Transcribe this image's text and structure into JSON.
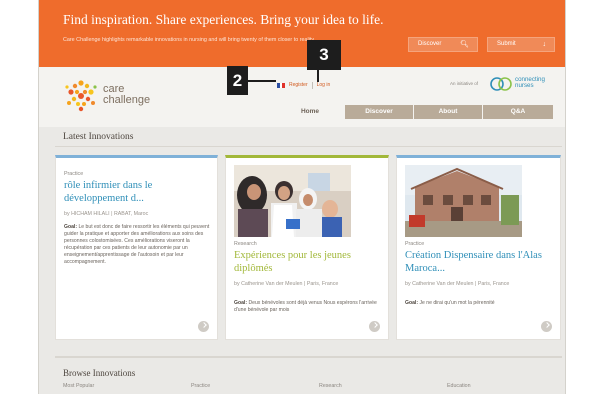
{
  "banner": {
    "headline": "Find inspiration. Share experiences. Bring your idea to life.",
    "description": "Care Challenge highlights remarkable innovations in nursing and will bring twenty of them closer to reality.",
    "discover_label": "Discover",
    "submit_label": "Submit",
    "accent_color": "#ef6c2c"
  },
  "header": {
    "logo_line1": "care",
    "logo_line2": "challenge",
    "register_label": "Register",
    "login_label": "Log in",
    "partner_label": "An initiative of",
    "partner_name_line1": "connecting",
    "partner_name_line2": "nurses"
  },
  "nav": {
    "tabs": [
      {
        "label": "Home",
        "active": true
      },
      {
        "label": "Discover"
      },
      {
        "label": "About"
      },
      {
        "label": "Q&A"
      }
    ]
  },
  "latest": {
    "title": "Latest Innovations",
    "cards": [
      {
        "category": "Practice",
        "title": "rôle infirmier dans le développement d...",
        "author": "by HICHAM HILALI | RABAT, Maroc",
        "goal_label": "Goal:",
        "goal": "Le but est donc de faire ressortir les éléments qui peuvent guider la pratique et apporter des améliorations aux soins des personnes colostomisées. Ces améliorations viseront la récupération par ces patients de leur autonomie par un enseignement/apprentissage de l'autosoin et par leur accompagnement."
      },
      {
        "category": "Research",
        "title": "Expériences pour les jeunes diplômés",
        "author": "by Catherine Van der Meulen | Paris, France",
        "goal_label": "Goal:",
        "goal": "Deux bénévoles sont déjà venus Nous espérons l'arrivée d'une bénévole par mois"
      },
      {
        "category": "Practice",
        "title": "Création Dispensaire dans l'Alas Maroca...",
        "author": "by Catherine Van der Meulen | Paris, France",
        "goal_label": "Goal:",
        "goal": "Je ne dirai qu'un mot la pérennité"
      }
    ]
  },
  "browse": {
    "title": "Browse Innovations",
    "columns": [
      "Most Popular",
      "Practice",
      "Research",
      "Education"
    ]
  },
  "annotations": {
    "badge_2": "2",
    "badge_3": "3"
  }
}
